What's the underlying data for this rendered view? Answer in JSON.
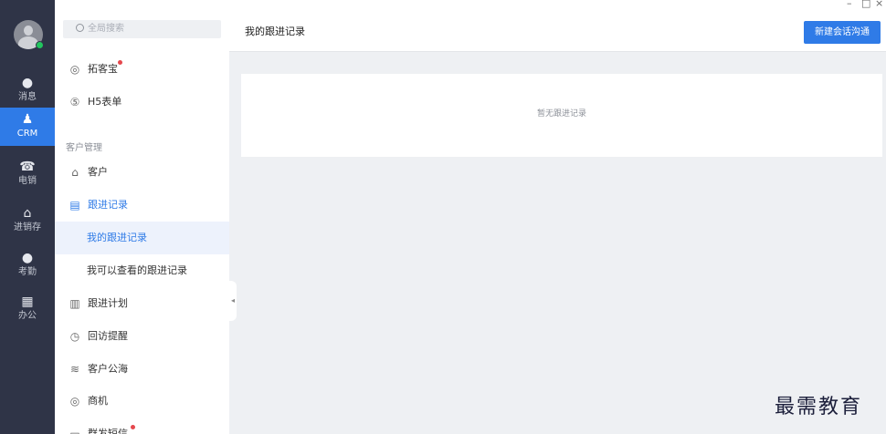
{
  "window": {
    "min_glyph": "–",
    "max_glyph": "□",
    "close_glyph": "×"
  },
  "rail": {
    "items": [
      {
        "label": "消息",
        "icon": "chat-bubble-icon",
        "glyph": "●"
      },
      {
        "label": "CRM",
        "icon": "person-icon",
        "glyph": "♟",
        "active": true
      },
      {
        "label": "电销",
        "icon": "phone-icon",
        "glyph": "☎"
      },
      {
        "label": "进销存",
        "icon": "home-icon",
        "glyph": "⌂"
      },
      {
        "label": "考勤",
        "icon": "location-pin-icon",
        "glyph": "●"
      },
      {
        "label": "办公",
        "icon": "grid-apps-icon",
        "glyph": "▦"
      }
    ]
  },
  "search": {
    "placeholder": "全局搜索"
  },
  "menu": {
    "items_top": [
      {
        "label": "拓客宝",
        "icon": "radar-icon",
        "glyph": "◎",
        "badge": true
      },
      {
        "label": "H5表单",
        "icon": "h5-form-icon",
        "glyph": "⑤"
      }
    ],
    "section_label": "客户管理",
    "items": [
      {
        "label": "客户",
        "icon": "building-icon",
        "glyph": "⌂"
      },
      {
        "label": "跟进记录",
        "icon": "calendar-icon",
        "glyph": "▤"
      },
      {
        "label": "我的跟进记录"
      },
      {
        "label": "我可以查看的跟进记录"
      },
      {
        "label": "跟进计划",
        "icon": "clipboard-icon",
        "glyph": "▥"
      },
      {
        "label": "回访提醒",
        "icon": "alarm-clock-icon",
        "glyph": "◷"
      },
      {
        "label": "客户公海",
        "icon": "waves-icon",
        "glyph": "≋"
      },
      {
        "label": "商机",
        "icon": "opportunity-icon",
        "glyph": "◎"
      },
      {
        "label": "群发短信",
        "icon": "message-icon",
        "glyph": "▭",
        "badge": true
      }
    ]
  },
  "main": {
    "title": "我的跟进记录",
    "new_button": "新建会话沟通",
    "empty_text": "暂无跟进记录"
  },
  "watermark": "最需教育",
  "colors": {
    "accent": "#2f7be7",
    "rail_bg": "#2f3447",
    "badge": "#e5484d"
  }
}
